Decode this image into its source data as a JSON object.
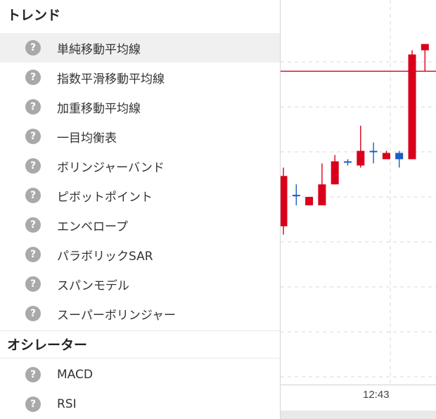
{
  "menu": {
    "sections": [
      {
        "title": "トレンド",
        "items": [
          {
            "label": "単純移動平均線",
            "active": true
          },
          {
            "label": "指数平滑移動平均線"
          },
          {
            "label": "加重移動平均線"
          },
          {
            "label": "一目均衡表"
          },
          {
            "label": "ボリンジャーバンド"
          },
          {
            "label": "ピボットポイント"
          },
          {
            "label": "エンベロープ"
          },
          {
            "label": "パラボリックSAR"
          },
          {
            "label": "スパンモデル"
          },
          {
            "label": "スーパーボリンジャー"
          }
        ]
      },
      {
        "title": "オシレーター",
        "items": [
          {
            "label": "MACD"
          },
          {
            "label": "RSI"
          }
        ]
      }
    ],
    "help_glyph": "?",
    "help_icon": "question-circle-icon"
  },
  "chart_data": {
    "type": "candlestick",
    "x_tick_label": "12:43",
    "colors": {
      "up": "#d9001b",
      "down": "#1a5cc8",
      "reference_line": "#d9001b",
      "grid": "#d9d9d9"
    },
    "candles": [
      {
        "open": 0.54,
        "close": 0.42,
        "high": 0.4,
        "low": 0.56,
        "color": "up"
      },
      {
        "open": 0.465,
        "close": 0.465,
        "high": 0.44,
        "low": 0.49,
        "color": "down"
      },
      {
        "open": 0.49,
        "close": 0.47,
        "high": 0.47,
        "low": 0.49,
        "color": "up"
      },
      {
        "open": 0.49,
        "close": 0.44,
        "high": 0.39,
        "low": 0.49,
        "color": "up"
      },
      {
        "open": 0.44,
        "close": 0.385,
        "high": 0.37,
        "low": 0.44,
        "color": "up"
      },
      {
        "open": 0.385,
        "close": 0.385,
        "high": 0.38,
        "low": 0.395,
        "color": "down"
      },
      {
        "open": 0.395,
        "close": 0.36,
        "high": 0.3,
        "low": 0.4,
        "color": "up"
      },
      {
        "open": 0.36,
        "close": 0.36,
        "high": 0.34,
        "low": 0.39,
        "color": "down"
      },
      {
        "open": 0.38,
        "close": 0.365,
        "high": 0.36,
        "low": 0.38,
        "color": "up"
      },
      {
        "open": 0.365,
        "close": 0.38,
        "high": 0.36,
        "low": 0.4,
        "color": "down"
      },
      {
        "open": 0.38,
        "close": 0.13,
        "high": 0.12,
        "low": 0.38,
        "color": "up"
      },
      {
        "open": 0.12,
        "close": 0.105,
        "high": 0.105,
        "low": 0.17,
        "color": "up"
      }
    ],
    "reference_level": 0.17
  }
}
